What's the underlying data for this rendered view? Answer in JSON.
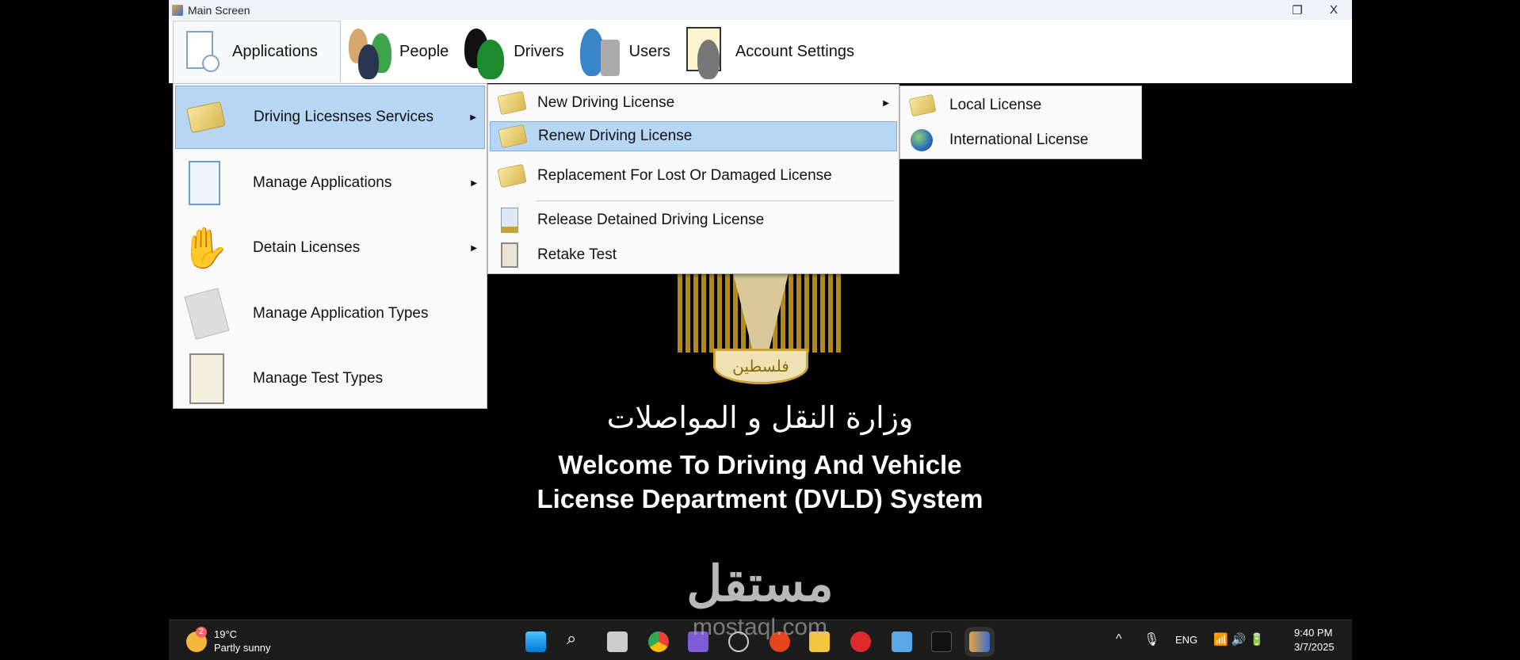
{
  "window": {
    "title": "Main Screen",
    "restore_icon": "restore-icon",
    "close_label": "X"
  },
  "menubar": {
    "items": [
      {
        "label": "Applications",
        "icon": "applications-icon"
      },
      {
        "label": "People",
        "icon": "people-icon"
      },
      {
        "label": "Drivers",
        "icon": "drivers-icon"
      },
      {
        "label": "Users",
        "icon": "users-icon"
      },
      {
        "label": "Account Settings",
        "icon": "account-settings-icon"
      }
    ]
  },
  "applications_menu": {
    "items": [
      {
        "label": "Driving Licesnses Services",
        "has_submenu": true,
        "highlighted": true
      },
      {
        "label": "Manage Applications",
        "has_submenu": true
      },
      {
        "label": "Detain Licenses",
        "has_submenu": true
      },
      {
        "label": "Manage Application Types"
      },
      {
        "label": "Manage Test Types"
      }
    ]
  },
  "services_menu": {
    "items": [
      {
        "label": "New Driving License",
        "has_submenu": true
      },
      {
        "label": "Renew Driving License",
        "highlighted": true
      },
      {
        "label": "Replacement For Lost Or Damaged License"
      },
      {
        "label": "Release Detained Driving License"
      },
      {
        "label": "Retake Test"
      }
    ]
  },
  "new_license_menu": {
    "items": [
      {
        "label": "Local License"
      },
      {
        "label": "International License"
      }
    ]
  },
  "main": {
    "emblem_text": "فلسطين",
    "ministry": "وزارة النقل و المواصلات",
    "welcome_line1": "Welcome To Driving And Vehicle",
    "welcome_line2": "License Department (DVLD) System"
  },
  "watermark": {
    "arabic": "مستقل",
    "latin": "mostaql.com"
  },
  "taskbar": {
    "weather_temp": "19°C",
    "weather_desc": "Partly sunny",
    "weather_badge": "2",
    "language": "ENG",
    "time": "9:40 PM",
    "date": "3/7/2025"
  }
}
